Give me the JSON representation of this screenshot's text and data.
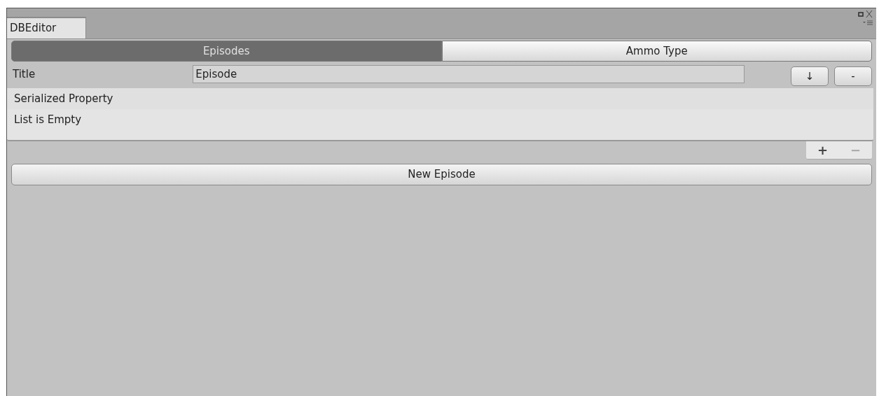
{
  "window": {
    "tab": "DBEditor"
  },
  "tabs": [
    {
      "label": "Episodes",
      "selected": true
    },
    {
      "label": "Ammo Type",
      "selected": false
    }
  ],
  "title_field": {
    "label": "Title",
    "value": "Episode"
  },
  "row_buttons": [
    "↓",
    "-"
  ],
  "list": {
    "header": "Serialized Property",
    "empty_text": "List is Empty",
    "footer_buttons": [
      "+",
      "−"
    ]
  },
  "new_button": "New Episode"
}
